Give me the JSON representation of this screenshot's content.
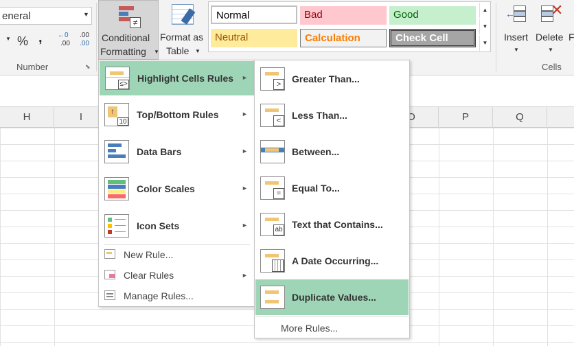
{
  "ribbon": {
    "number_format_value": "eneral",
    "percent_symbol": "%",
    "comma_symbol": ",",
    "inc_decimal_label": ".00",
    "dec_decimal_label": ".00",
    "number_group_label": "Number",
    "conditional_formatting_line1": "Conditional",
    "conditional_formatting_line2": "Formatting",
    "format_as_table_line1": "Format as",
    "format_as_table_line2": "Table",
    "insert_label": "Insert",
    "delete_label": "Delete",
    "format_partial": "F",
    "cells_group_label": "Cells",
    "styles": [
      {
        "label": "Normal",
        "fg": "#000000",
        "bg": "#ffffff"
      },
      {
        "label": "Bad",
        "fg": "#9c0006",
        "bg": "#ffc7ce"
      },
      {
        "label": "Good",
        "fg": "#006100",
        "bg": "#c6efce"
      },
      {
        "label": "Neutral",
        "fg": "#9c5700",
        "bg": "#ffeb9c"
      },
      {
        "label": "Calculation",
        "fg": "#fa7d00",
        "bg": "#f2f2f2"
      },
      {
        "label": "Check Cell",
        "fg": "#ffffff",
        "bg": "#a5a5a5"
      }
    ]
  },
  "columns": [
    "H",
    "I",
    "O",
    "P",
    "Q"
  ],
  "cf_menu": {
    "items": [
      {
        "label": "Highlight Cells Rules",
        "highlighted": true
      },
      {
        "label": "Top/Bottom Rules",
        "highlighted": false
      },
      {
        "label": "Data Bars",
        "highlighted": false
      },
      {
        "label": "Color Scales",
        "highlighted": false
      },
      {
        "label": "Icon Sets",
        "highlighted": false
      }
    ],
    "small_items": [
      {
        "label": "New Rule..."
      },
      {
        "label": "Clear Rules"
      },
      {
        "label": "Manage Rules..."
      }
    ]
  },
  "highlight_submenu": {
    "items": [
      {
        "label": "Greater Than..."
      },
      {
        "label": "Less Than..."
      },
      {
        "label": "Between..."
      },
      {
        "label": "Equal To..."
      },
      {
        "label": "Text that Contains..."
      },
      {
        "label": "A Date Occurring..."
      },
      {
        "label": "Duplicate Values..."
      }
    ],
    "more_rules": "More Rules...",
    "glyphs": {
      "greater": ">",
      "less": "<",
      "equal": "=",
      "text": "ab"
    }
  },
  "colors": {
    "accent_highlight": "#9fd5b7",
    "ribbon_bg": "#f3f3f3"
  }
}
